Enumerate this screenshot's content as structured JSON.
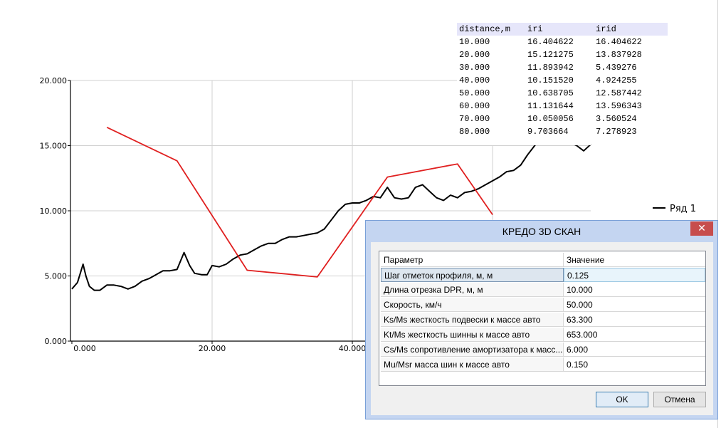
{
  "chart_data": {
    "type": "line",
    "x_ticks": [
      "0.000",
      "20.000",
      "40.000"
    ],
    "y_ticks": [
      "0.000",
      "5.000",
      "10.000",
      "15.000",
      "20.000"
    ],
    "xlim": [
      -0.2,
      74
    ],
    "ylim": [
      0,
      20
    ],
    "grid": true,
    "legend_position": "right",
    "series": [
      {
        "name": "Ряд 1",
        "color": "#000000",
        "points": [
          [
            0,
            4.0
          ],
          [
            0.8,
            4.5
          ],
          [
            1.2,
            5.2
          ],
          [
            1.6,
            5.9
          ],
          [
            2.0,
            5.0
          ],
          [
            2.5,
            4.2
          ],
          [
            3.2,
            3.9
          ],
          [
            4.0,
            3.9
          ],
          [
            5.0,
            4.3
          ],
          [
            6.0,
            4.3
          ],
          [
            7.0,
            4.2
          ],
          [
            8.0,
            4.0
          ],
          [
            9.0,
            4.2
          ],
          [
            10.0,
            4.6
          ],
          [
            11.0,
            4.8
          ],
          [
            12.0,
            5.1
          ],
          [
            13.0,
            5.4
          ],
          [
            14.0,
            5.4
          ],
          [
            15.0,
            5.5
          ],
          [
            16.0,
            6.8
          ],
          [
            16.8,
            5.8
          ],
          [
            17.5,
            5.2
          ],
          [
            18.5,
            5.1
          ],
          [
            19.3,
            5.1
          ],
          [
            20.0,
            5.8
          ],
          [
            21.0,
            5.7
          ],
          [
            22.0,
            5.9
          ],
          [
            23.0,
            6.3
          ],
          [
            24.0,
            6.6
          ],
          [
            25.0,
            6.7
          ],
          [
            26.0,
            7.0
          ],
          [
            27.0,
            7.3
          ],
          [
            28.0,
            7.5
          ],
          [
            29.0,
            7.5
          ],
          [
            30.0,
            7.8
          ],
          [
            31.0,
            8.0
          ],
          [
            32.0,
            8.0
          ],
          [
            33.0,
            8.1
          ],
          [
            34.0,
            8.2
          ],
          [
            35.0,
            8.3
          ],
          [
            36.0,
            8.6
          ],
          [
            37.0,
            9.3
          ],
          [
            38.0,
            10.0
          ],
          [
            39.0,
            10.5
          ],
          [
            40.0,
            10.6
          ],
          [
            41.0,
            10.6
          ],
          [
            42.0,
            10.8
          ],
          [
            43.0,
            11.1
          ],
          [
            44.0,
            11.0
          ],
          [
            45.0,
            11.8
          ],
          [
            46.0,
            11.0
          ],
          [
            47.0,
            10.9
          ],
          [
            48.0,
            11.0
          ],
          [
            49.0,
            11.8
          ],
          [
            50.0,
            12.0
          ],
          [
            51.0,
            11.5
          ],
          [
            52.0,
            11.0
          ],
          [
            53.0,
            10.8
          ],
          [
            54.0,
            11.2
          ],
          [
            55.0,
            11.0
          ],
          [
            56.0,
            11.4
          ],
          [
            57.0,
            11.5
          ],
          [
            58.0,
            11.7
          ],
          [
            59.0,
            12.0
          ],
          [
            60.0,
            12.3
          ],
          [
            61.0,
            12.6
          ],
          [
            62.0,
            13.0
          ],
          [
            63.0,
            13.1
          ],
          [
            64.0,
            13.5
          ],
          [
            65.0,
            14.3
          ],
          [
            66.0,
            15.0
          ],
          [
            67.0,
            15.7
          ],
          [
            68.0,
            16.0
          ],
          [
            72.0,
            15.0
          ],
          [
            73.0,
            14.6
          ],
          [
            74.0,
            15.1
          ]
        ]
      },
      {
        "name": "irid",
        "color": "#e02020",
        "points": [
          [
            5,
            16.404622
          ],
          [
            15,
            13.837928
          ],
          [
            25,
            5.439276
          ],
          [
            35,
            4.924255
          ],
          [
            45,
            12.587442
          ],
          [
            55,
            13.596343
          ],
          [
            60,
            9.7
          ]
        ]
      }
    ]
  },
  "table": {
    "headers": [
      "distance,m",
      "iri",
      "irid"
    ],
    "rows": [
      [
        "10.000",
        "16.404622",
        "16.404622"
      ],
      [
        "20.000",
        "15.121275",
        "13.837928"
      ],
      [
        "30.000",
        "11.893942",
        "5.439276"
      ],
      [
        "40.000",
        "10.151520",
        "4.924255"
      ],
      [
        "50.000",
        "10.638705",
        "12.587442"
      ],
      [
        "60.000",
        "11.131644",
        "13.596343"
      ],
      [
        "70.000",
        "10.050056",
        "3.560524"
      ],
      [
        "80.000",
        "9.703664",
        "7.278923"
      ]
    ]
  },
  "dialog": {
    "title": "КРЕДО 3D СКАН",
    "close_label": "✕",
    "col_param": "Параметр",
    "col_value": "Значение",
    "rows": [
      {
        "param": "Шаг отметок профиля, м, м",
        "value": "0.125"
      },
      {
        "param": "Длина отрезка DPR, м, м",
        "value": "10.000"
      },
      {
        "param": "Скорость, км/ч",
        "value": "50.000"
      },
      {
        "param": "Ks/Ms жесткость подвески к массе авто",
        "value": "63.300"
      },
      {
        "param": "Kt/Ms жесткость шинны к массе авто",
        "value": "653.000"
      },
      {
        "param": "Cs/Ms сопротивление амортизатора к масс...",
        "value": "6.000"
      },
      {
        "param": "Mu/Msr масса шин к массе авто",
        "value": "0.150"
      }
    ],
    "ok_label": "OK",
    "cancel_label": "Отмена"
  }
}
